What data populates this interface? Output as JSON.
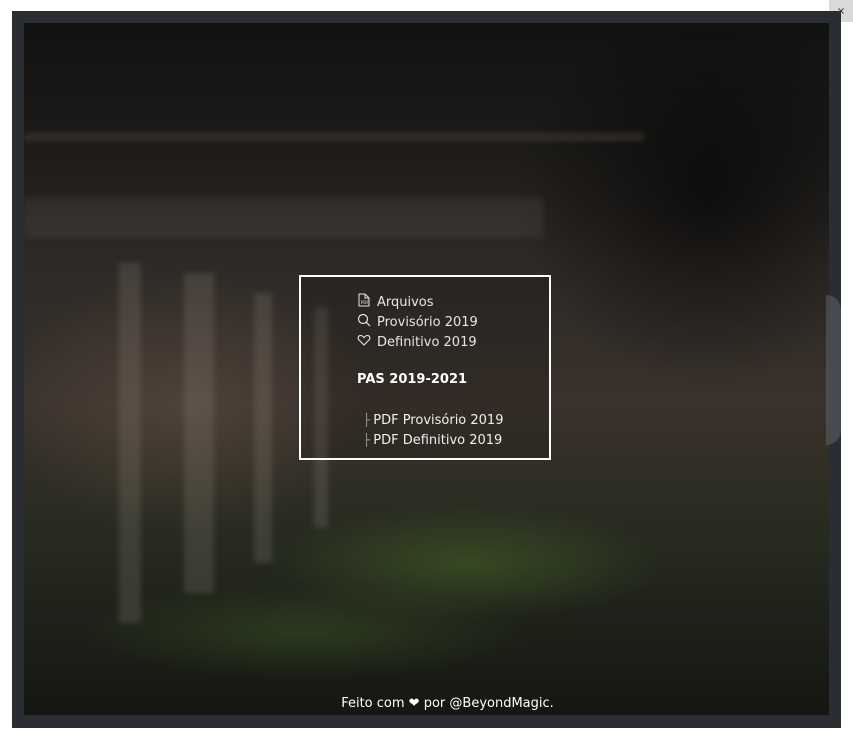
{
  "close_button": {
    "label": "×"
  },
  "menu": {
    "items": [
      {
        "label": "Arquivos",
        "icon": "pdf-file-icon"
      },
      {
        "label": "Provisório 2019",
        "icon": "search-icon"
      },
      {
        "label": "Definitivo 2019",
        "icon": "heart-icon"
      }
    ],
    "section_title": "PAS 2019-2021",
    "sub_items": [
      {
        "glyph": "├",
        "label": "PDF Provisório 2019"
      },
      {
        "glyph": "├",
        "label": "PDF Definitivo 2019"
      }
    ]
  },
  "footer": {
    "prefix": "Feito com",
    "heart": "❤",
    "middle": "por",
    "author": "@BeyondMagic",
    "suffix": "."
  },
  "colors": {
    "frame": "#2a2e33",
    "menu_border": "#ffffff",
    "text": "#e6e6e6"
  }
}
